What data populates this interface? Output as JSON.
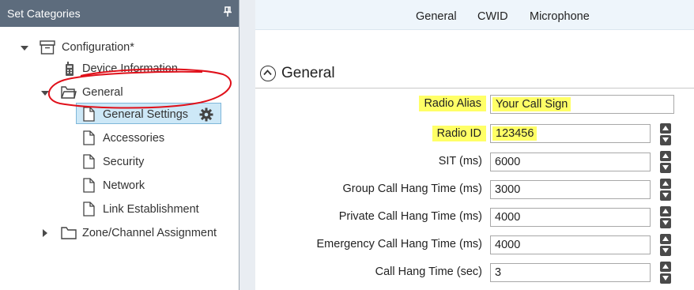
{
  "left_panel": {
    "title": "Set Categories",
    "tree": {
      "configuration": "Configuration*",
      "device_information": "Device Information",
      "general": "General",
      "general_settings": "General Settings",
      "accessories": "Accessories",
      "security": "Security",
      "network": "Network",
      "link_establishment": "Link Establishment",
      "zone_channel_assignment": "Zone/Channel Assignment"
    }
  },
  "tabs": [
    "General",
    "CWID",
    "Microphone"
  ],
  "section": {
    "title": "General"
  },
  "fields": [
    {
      "label": "Radio Alias",
      "value": "Your Call Sign"
    },
    {
      "label": "Radio ID",
      "value": "123456"
    },
    {
      "label": "SIT (ms)",
      "value": "6000"
    },
    {
      "label": "Group Call Hang Time (ms)",
      "value": "3000"
    },
    {
      "label": "Private Call Hang Time (ms)",
      "value": "4000"
    },
    {
      "label": "Emergency Call Hang Time (ms)",
      "value": "4000"
    },
    {
      "label": "Call Hang Time (sec)",
      "value": "3"
    }
  ],
  "colors": {
    "highlight": "#ffff66",
    "panel_header": "#5d6c7d",
    "selection": "#cde8f7",
    "annotation": "#e0101a"
  }
}
